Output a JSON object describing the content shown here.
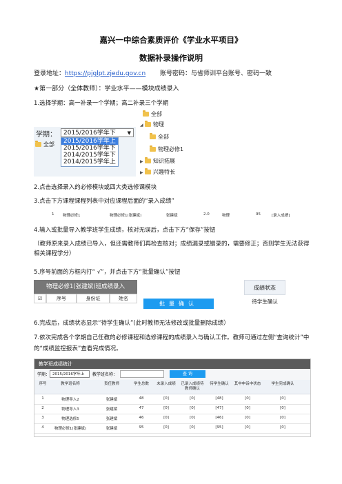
{
  "doc": {
    "title": "嘉兴一中综合素质评价《学业水平项目》",
    "subtitle": "数据补录操作说明",
    "address_label": "登录地址：",
    "address_url": "https://pjglpt.zjedu.gov.cn",
    "account_text": "账号密码：与省师训平台账号、密码一致",
    "part1": "★第一部分（全体教师）：学业水平——模块成绩录入",
    "step1": "1.选择学期：高一补录一个学期；高二补录三个学期",
    "step2": "2.点击选择录入的必修模块或四大类选修课模块",
    "step3": "3.点击下方课程课程列表中对应课程后面的“录入成绩”",
    "step4": "4.输入或批量导入教学班学生成绩，核对无误后，点击下方“保存”按钮",
    "step4_note": "（教师原来录入成绩已导入，但还需教师们再检查核对；成绩漏录或错录的，需要修正；否则学生无法获得相关课程学分）",
    "step5": "5.序号前面的方框内打“ √”，并点击下方“批量确认”按钮",
    "step6": "6.完成后，成绩状态显示“待学生确认”(此时教师无法修改或批量删除成绩）",
    "step7": "7.依次完成各个学期自己任教的必修课程和选修课程的成绩录入与确认工作。教师可通过左侧“查询统计”中的“成绩监控报表”查看完成情况。"
  },
  "semester_widget": {
    "label": "学期：",
    "selected": "2015/2016学年下",
    "options": [
      "2015/2016学年上",
      "2015/2016学年下",
      "2014/2015学年下",
      "2014/2015学年上"
    ],
    "partial_tab": "全部"
  },
  "tree": {
    "items": [
      "全部",
      "物理",
      "全部",
      "物理必修1",
      "知识拓展",
      "兴趣特长"
    ]
  },
  "course_row": {
    "cells": [
      "1",
      "物理必修1",
      "物理必修1(张建斌)",
      "张建斌",
      "2.0",
      "物理",
      "95",
      "[录入成绩]"
    ]
  },
  "step5_panel": {
    "title": "物理必修1(张建斌)班成绩录入",
    "headers": [
      "☑",
      "序号",
      "身份证",
      "姓名"
    ],
    "button": "批量确认"
  },
  "step6_panel": {
    "header": "成绩状态",
    "value": "待学生确认"
  },
  "stats": {
    "title": "教学班成绩统计",
    "semester_label": "学期：",
    "semester_value": "2015/2016学年上",
    "class_label": "教学班名称：",
    "query": "查 询",
    "headers": [
      "序号",
      "教学班名称",
      "责任教师",
      "学生总数",
      "未录入成绩",
      "已录入成绩待教师确认",
      "待学生确认",
      "其中申诉中状态",
      "学生完成确认"
    ],
    "rows": [
      [
        "1",
        "物理导入2",
        "张建斌",
        "48",
        "[0]",
        "[0]",
        "[48]",
        "[0]",
        "[0]"
      ],
      [
        "2",
        "物理导入3",
        "张建斌",
        "47",
        "[0]",
        "[0]",
        "[47]",
        "[0]",
        "[0]"
      ],
      [
        "3",
        "物理选修5",
        "张建斌",
        "46",
        "[0]",
        "[0]",
        "[46]",
        "[0]",
        "[0]"
      ],
      [
        "4",
        "物理必修1(张建斌)",
        "张建斌",
        "95",
        "[0]",
        "[0]",
        "[95]",
        "[0]",
        "[0]"
      ]
    ]
  },
  "colors": {
    "link": "#1a55c8",
    "highlight": "#3d7fe0",
    "button": "#1d9bf0",
    "panel": "#777777"
  }
}
